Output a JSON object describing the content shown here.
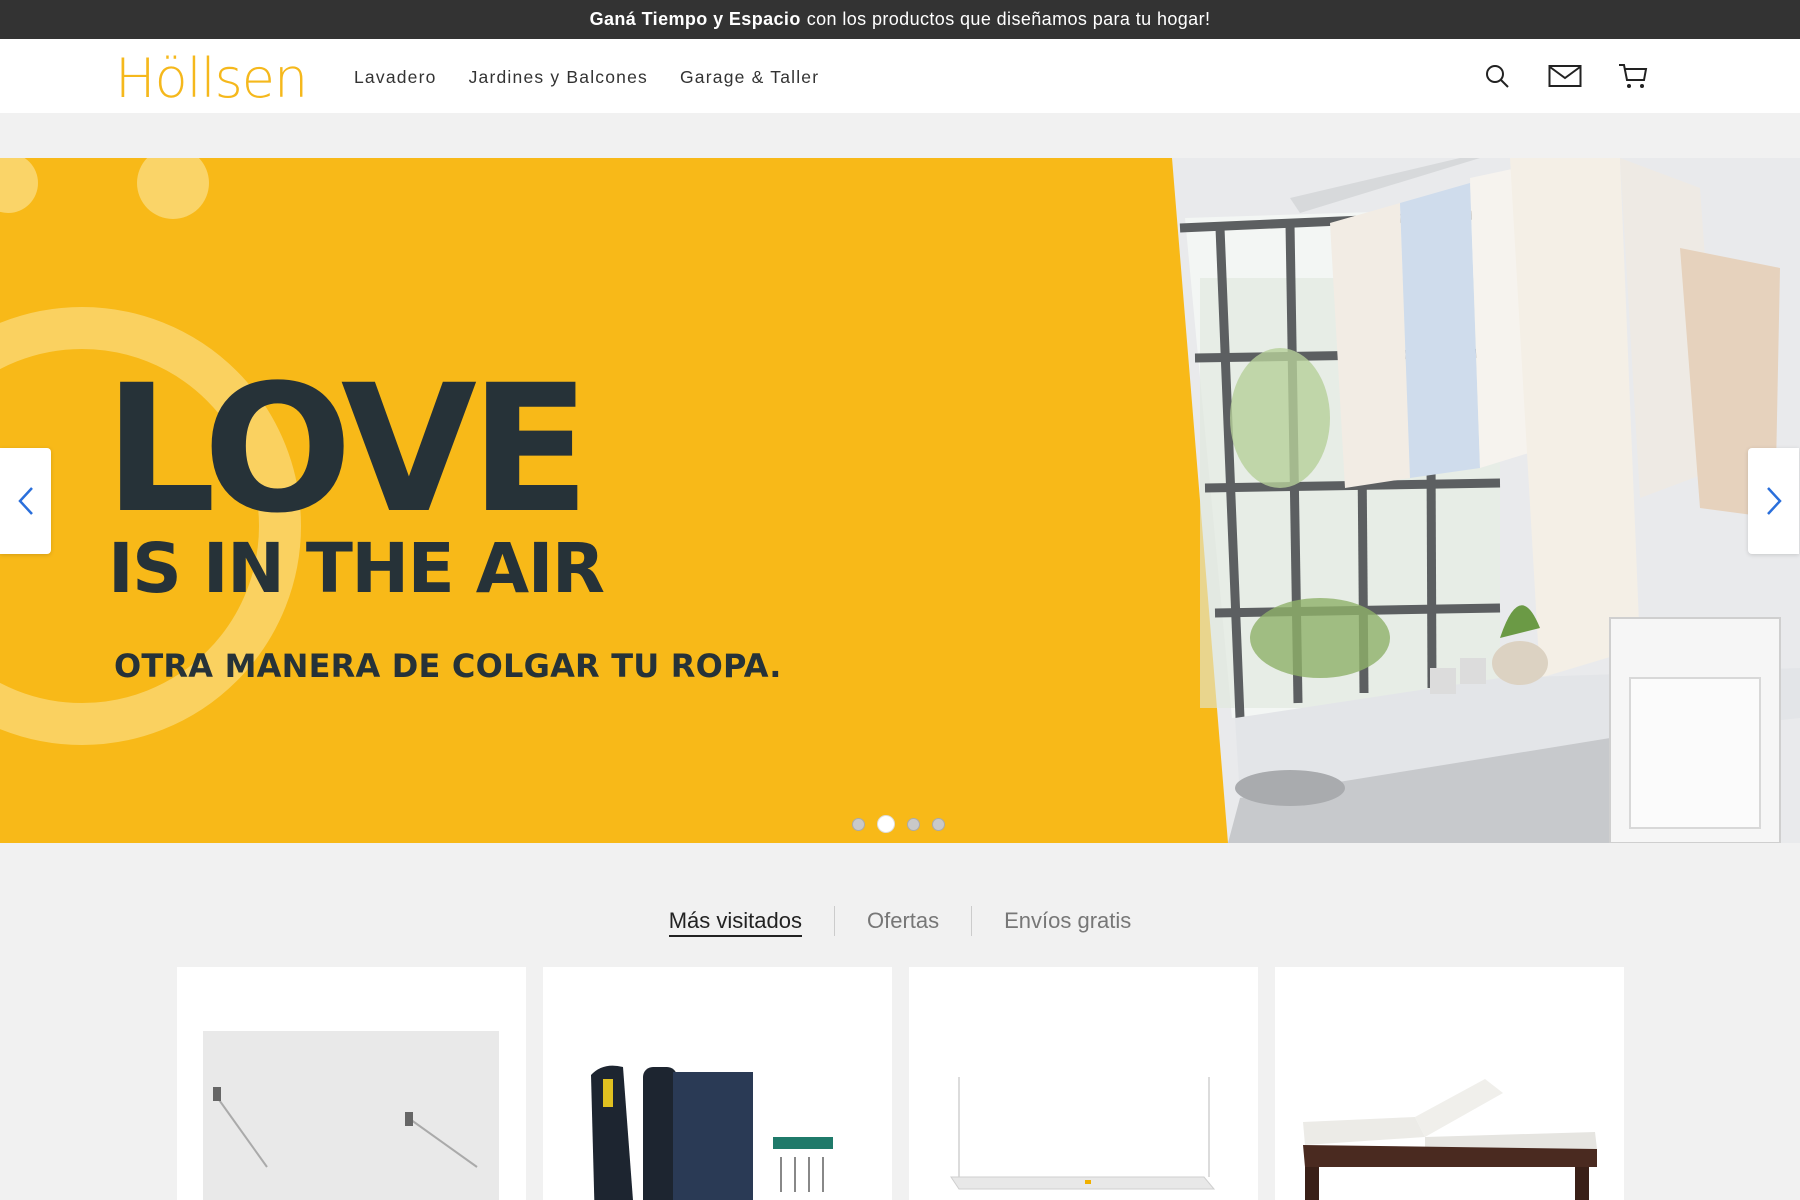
{
  "promo": {
    "bold": "Ganá Tiempo y Espacio",
    "text": "con los productos que diseñamos para tu hogar!"
  },
  "header": {
    "logo": "Höllsen",
    "nav": [
      "Lavadero",
      "Jardines y Balcones",
      "Garage & Taller"
    ],
    "icons": [
      "search-icon",
      "mail-icon",
      "cart-icon"
    ]
  },
  "hero": {
    "title": "LOVE",
    "subtitle": "IS IN THE AIR",
    "tagline": "OTRA MANERA DE COLGAR TU ROPA.",
    "slides": 4,
    "active_slide": 2,
    "accent_color": "#f8b918"
  },
  "tabs": [
    "Más visitados",
    "Ofertas",
    "Envíos gratis"
  ],
  "active_tab": "Más visitados",
  "products": [
    "wall-drying-rack",
    "fabric-rolls-kit",
    "ceiling-drying-rack",
    "sun-lounger"
  ]
}
